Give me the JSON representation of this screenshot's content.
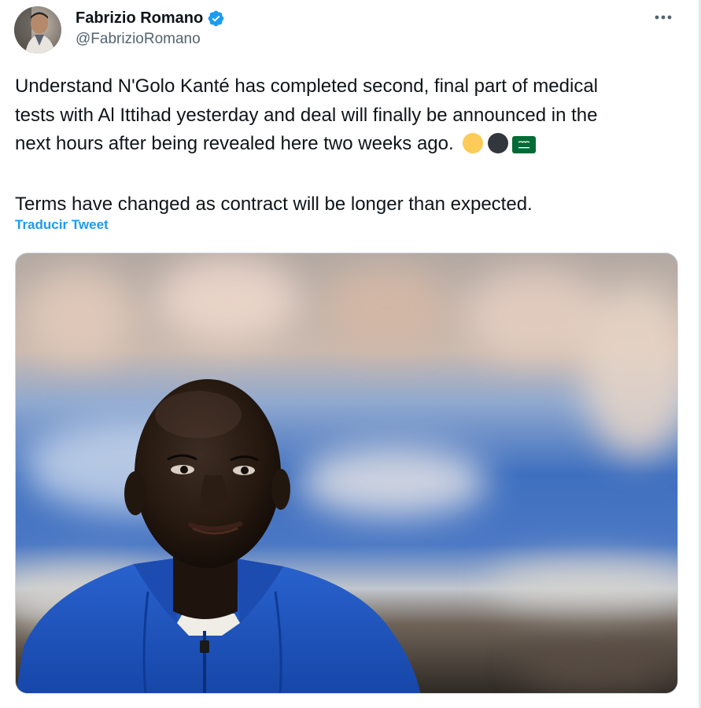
{
  "author": {
    "display_name": "Fabrizio Romano",
    "handle": "@FabrizioRomano",
    "verified": true,
    "avatar_icon": "profile-photo"
  },
  "tweet": {
    "line1": "Understand N'Golo Kanté has completed second, final part of medical",
    "line2": "tests with Al Ittihad yesterday and deal will finally be announced in the",
    "line3": "next hours after being revealed here two weeks ago.",
    "line4": "Terms have changed as contract will be longer than expected.",
    "emojis": [
      "yellow-circle",
      "black-circle",
      "saudi-arabia-flag"
    ],
    "translate_label": "Traducir Tweet"
  },
  "media": {
    "description_icon": "photo-of-player-in-blue-hoodie"
  },
  "menu": {
    "more_icon": "more-options-icon"
  },
  "colors": {
    "link": "#1d9bf0",
    "verified": "#1d9bf0",
    "secondary_text": "#536471",
    "primary_text": "#0f1419",
    "emoji_yellow": "#fdcb58",
    "emoji_black": "#31373d",
    "flag_green": "#006c35"
  }
}
